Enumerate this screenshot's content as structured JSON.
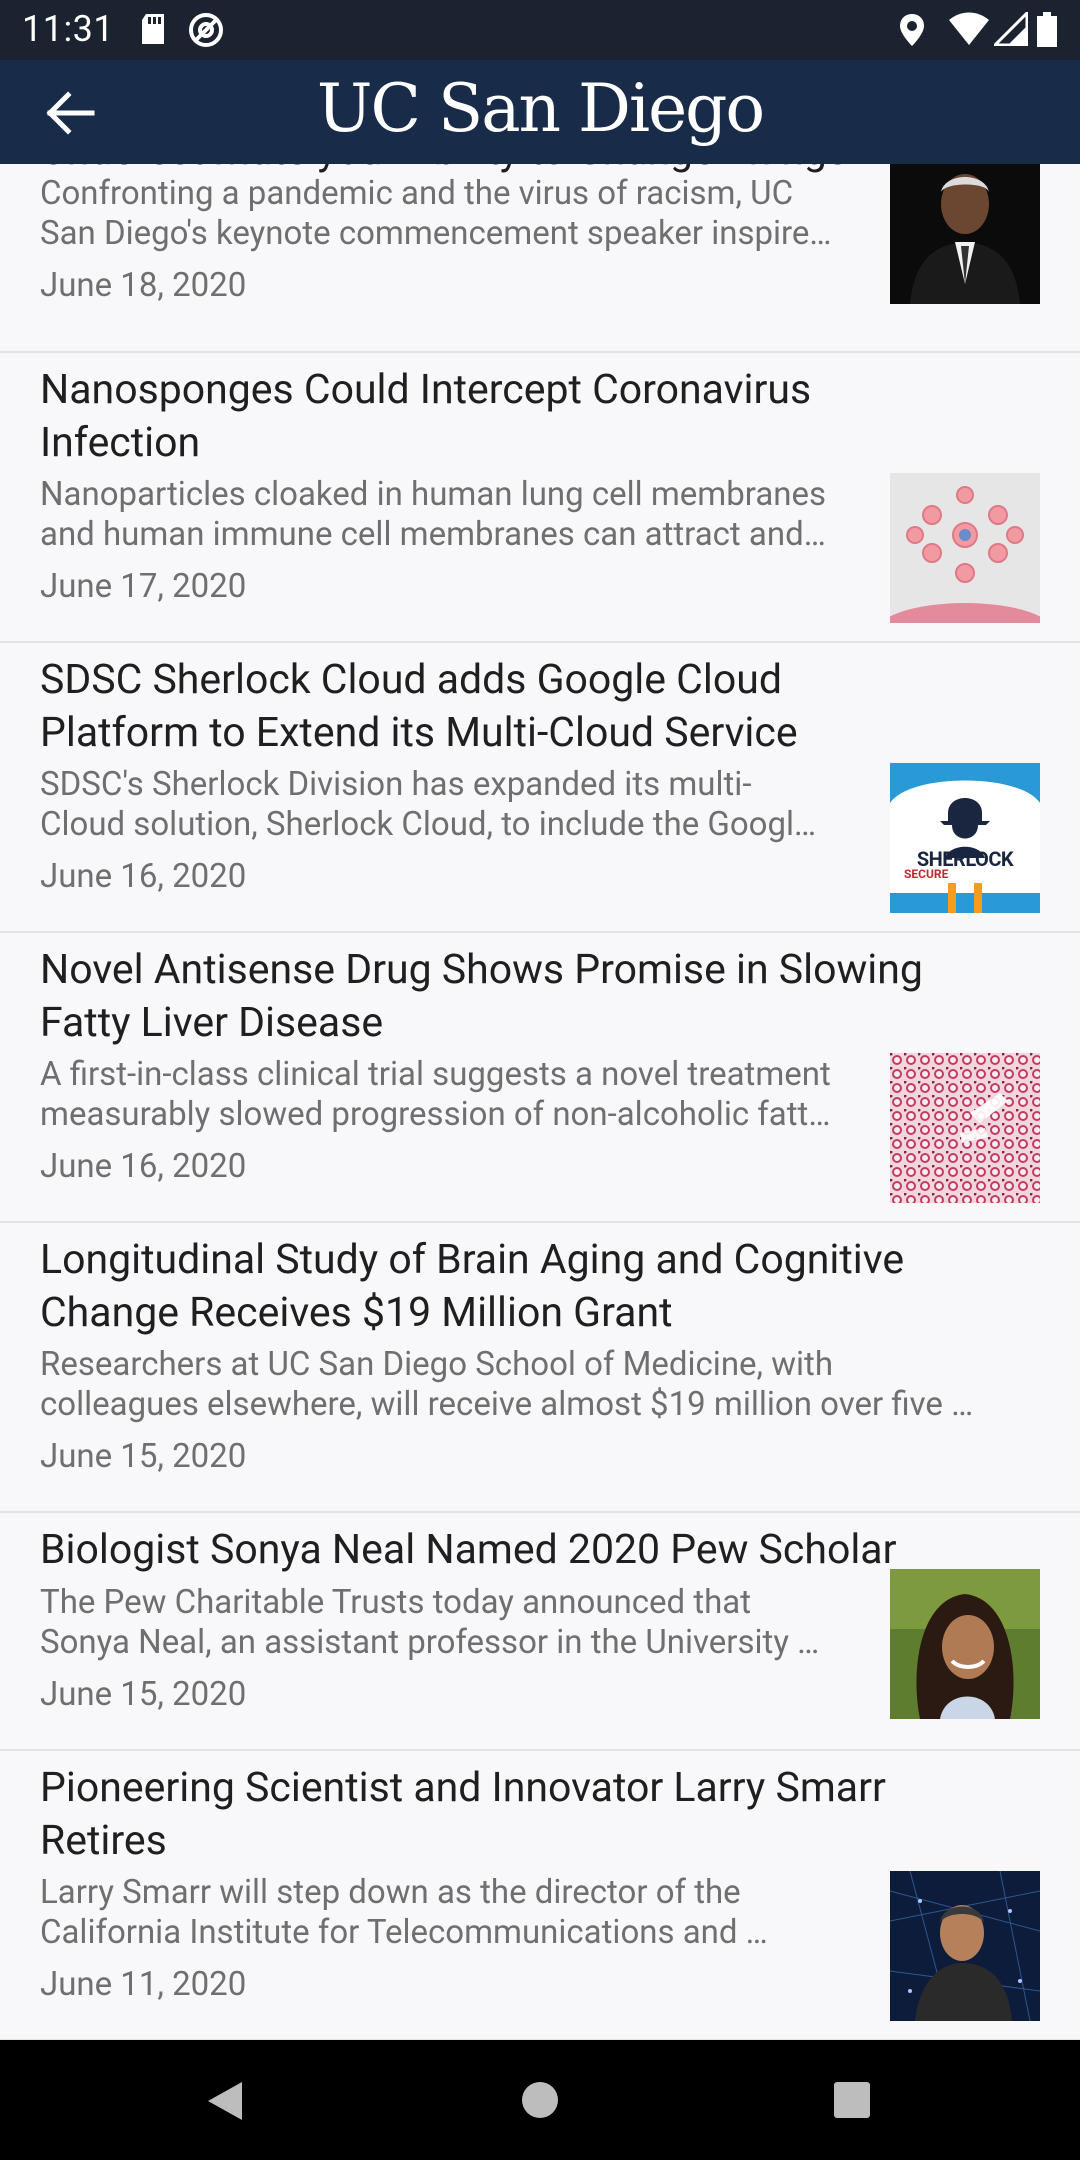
{
  "status_bar": {
    "time": "11:31",
    "icons": [
      "sd-card-icon",
      "at-sign-icon",
      "location-icon",
      "wifi-icon",
      "signal-icon",
      "battery-icon"
    ]
  },
  "app_bar": {
    "logo_text": "UC San Diego",
    "back_icon": "back-arrow-icon",
    "colors": {
      "bar": "#182b49"
    }
  },
  "articles": [
    {
      "title": "Underestimate your Ability to Change Things",
      "desc_line1": "Confronting a pandemic and the virus of racism, UC",
      "desc_line2": "San Diego's keynote commencement speaker inspire…",
      "date": "June 18, 2020"
    },
    {
      "title_line1": "Nanosponges Could Intercept Coronavirus",
      "title_line2": "Infection",
      "desc_line1": "Nanoparticles cloaked in human lung cell membranes",
      "desc_line2": "and human immune cell membranes can attract and…",
      "date": "June 17, 2020"
    },
    {
      "title_line1": "SDSC Sherlock Cloud adds Google Cloud",
      "title_line2": "Platform to Extend its Multi-Cloud Service",
      "desc_line1": "SDSC's Sherlock Division has expanded its multi-",
      "desc_line2": "Cloud solution, Sherlock Cloud, to include the Googl…",
      "date": "June 16, 2020",
      "thumb_text": "SHERLOCK",
      "thumb_sub": "SECURE"
    },
    {
      "title_line1": "Novel Antisense Drug Shows Promise in Slowing",
      "title_line2": "Fatty Liver Disease",
      "desc_line1": "A first-in-class clinical trial suggests a novel treatment",
      "desc_line2": "measurably slowed progression of non-alcoholic fatt…",
      "date": "June 16, 2020"
    },
    {
      "title_line1": "Longitudinal Study of Brain Aging and Cognitive",
      "title_line2": "Change Receives $19 Million Grant",
      "desc_line1": "Researchers at UC San Diego School of Medicine, with",
      "desc_line2": "colleagues elsewhere, will receive almost $19 million over five …",
      "date": "June 15, 2020"
    },
    {
      "title": "Biologist Sonya Neal Named 2020 Pew Scholar",
      "desc_line1": "The Pew Charitable Trusts today announced that",
      "desc_line2": "Sonya Neal, an assistant professor in the University …",
      "date": "June 15, 2020"
    },
    {
      "title_line1": "Pioneering Scientist and Innovator Larry Smarr",
      "title_line2": "Retires",
      "desc_line1": "Larry Smarr will step down as the director of the",
      "desc_line2": "California Institute for Telecommunications and …",
      "date": "June 11, 2020"
    }
  ],
  "nav_bar": {
    "icons": [
      "back-triangle-icon",
      "home-circle-icon",
      "recents-square-icon"
    ]
  }
}
